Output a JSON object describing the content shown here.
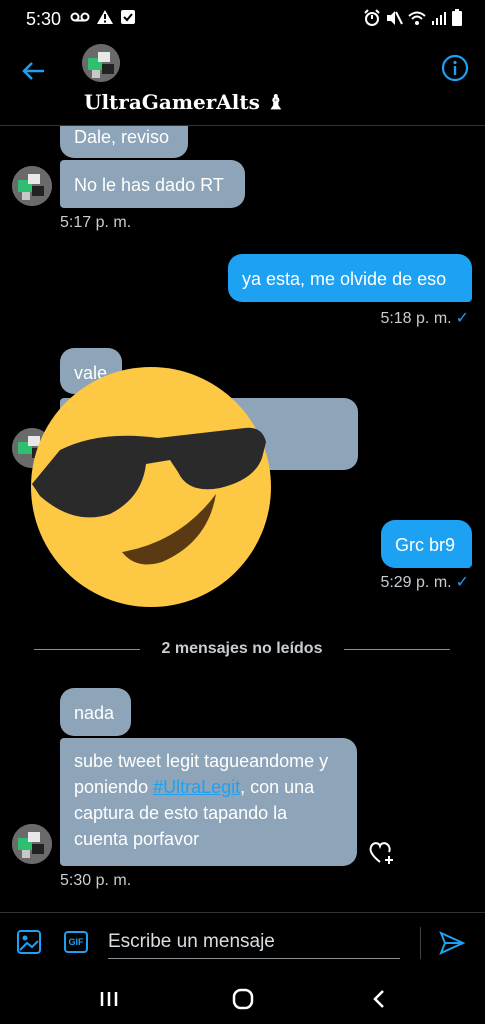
{
  "status_bar": {
    "time": "5:30"
  },
  "header": {
    "contact_name": "UltraGamerAlts ♝"
  },
  "messages": {
    "m1": "Dale, reviso",
    "m2": "No le has dado RT",
    "t1": "5:17 p. m.",
    "m3": "ya esta, me olvide de eso",
    "t2": "5:18 p. m.",
    "m4": "vale",
    "m6": "Grc br9",
    "t4": "5:29 p. m.",
    "unread_divider": "2 mensajes no leídos",
    "m7": "nada",
    "m8_part1": "sube tweet legit tagueandome y poniendo ",
    "m8_hashtag": "#UltraLegit",
    "m8_part2": ", con una captura de esto tapando la cuenta porfavor",
    "t5": "5:30 p. m.",
    "check": "✓"
  },
  "composer": {
    "placeholder": "Escribe un mensaje",
    "gif_label": "GIF"
  },
  "colors": {
    "accent": "#1da1f2",
    "incoming_bubble": "#8ea4b8",
    "background": "#000000"
  },
  "icons": {
    "back": "arrow-left-icon",
    "info": "info-icon",
    "media": "image-icon",
    "gif": "gif-icon",
    "send": "send-icon",
    "react": "heart-plus-icon",
    "emoji": "sunglasses-emoji"
  }
}
